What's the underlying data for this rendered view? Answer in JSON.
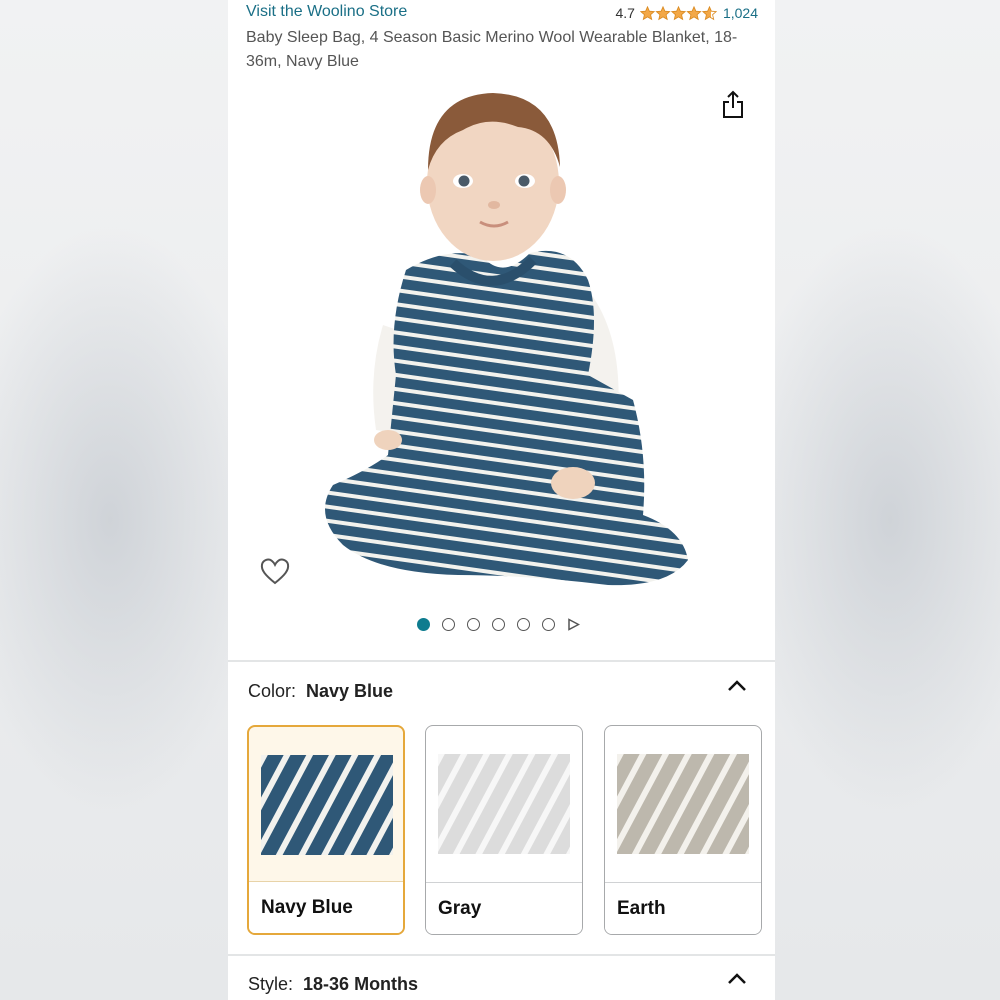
{
  "header": {
    "store_link": "Visit the Woolino Store",
    "rating_value": "4.7",
    "rating_stars": 4.7,
    "rating_count": "1,024",
    "star_color": "#f3a847",
    "link_color": "#1a6f86"
  },
  "product": {
    "title": "Baby Sleep Bag, 4 Season Basic Merino Wool Wearable Blanket, 18-36m, Navy Blue",
    "share_icon": "share-icon",
    "wishlist_icon": "heart-outline-icon",
    "image_count": 6,
    "active_image_index": 0,
    "has_video_indicator": true
  },
  "color_selector": {
    "label": "Color:",
    "selected": "Navy Blue",
    "options": [
      {
        "name": "Navy Blue",
        "bg": "#2f5877",
        "stripe": "#f2f2ee",
        "selected": true
      },
      {
        "name": "Gray",
        "bg": "#dcdcdc",
        "stripe": "#f7f7f7",
        "selected": false
      },
      {
        "name": "Earth",
        "bg": "#bdb8ad",
        "stripe": "#f3f1ec",
        "selected": false
      }
    ],
    "selected_border_color": "#e5a83b"
  },
  "style_selector": {
    "label": "Style:",
    "selected": "18-36 Months"
  }
}
